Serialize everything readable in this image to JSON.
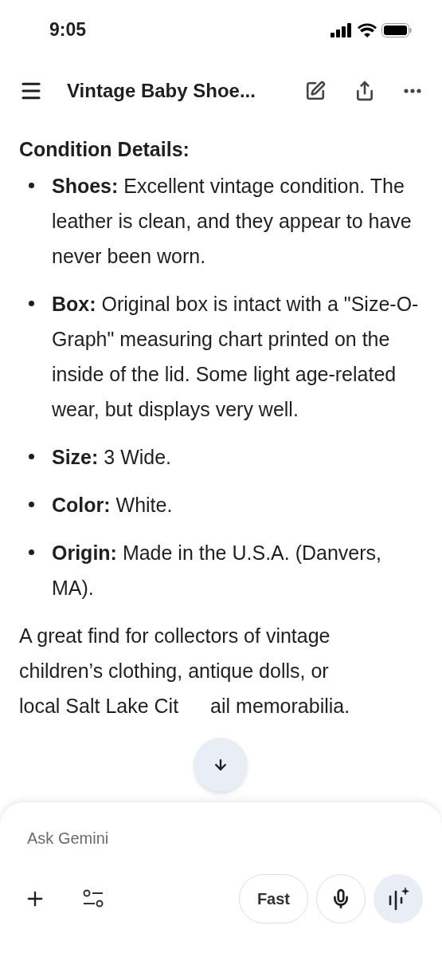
{
  "status_bar": {
    "time": "9:05"
  },
  "header": {
    "title": "Vintage Baby Shoe..."
  },
  "content": {
    "heading": "Condition Details:",
    "bullets": [
      "**Shoes:** Excellent vintage condition. The leather is clean, and they appear to have never been worn.",
      "**Box:** Original box is intact with a \"Size-O-Graph\" measuring chart printed on the inside of the lid. Some light age-related wear, but displays very well.",
      "**Size:** 3 Wide.",
      "**Color:** White.",
      "**Origin:** Made in the U.S.A. (Danvers, MA)."
    ],
    "closing_lines": [
      "A great find for collectors of vintage",
      "children’s clothing, antique dolls, or"
    ],
    "closing_visible_start": "local Salt Lake Cit",
    "closing_visible_end": "ail memorabilia."
  },
  "composer": {
    "placeholder": "Ask Gemini",
    "mode_button": "Fast"
  }
}
